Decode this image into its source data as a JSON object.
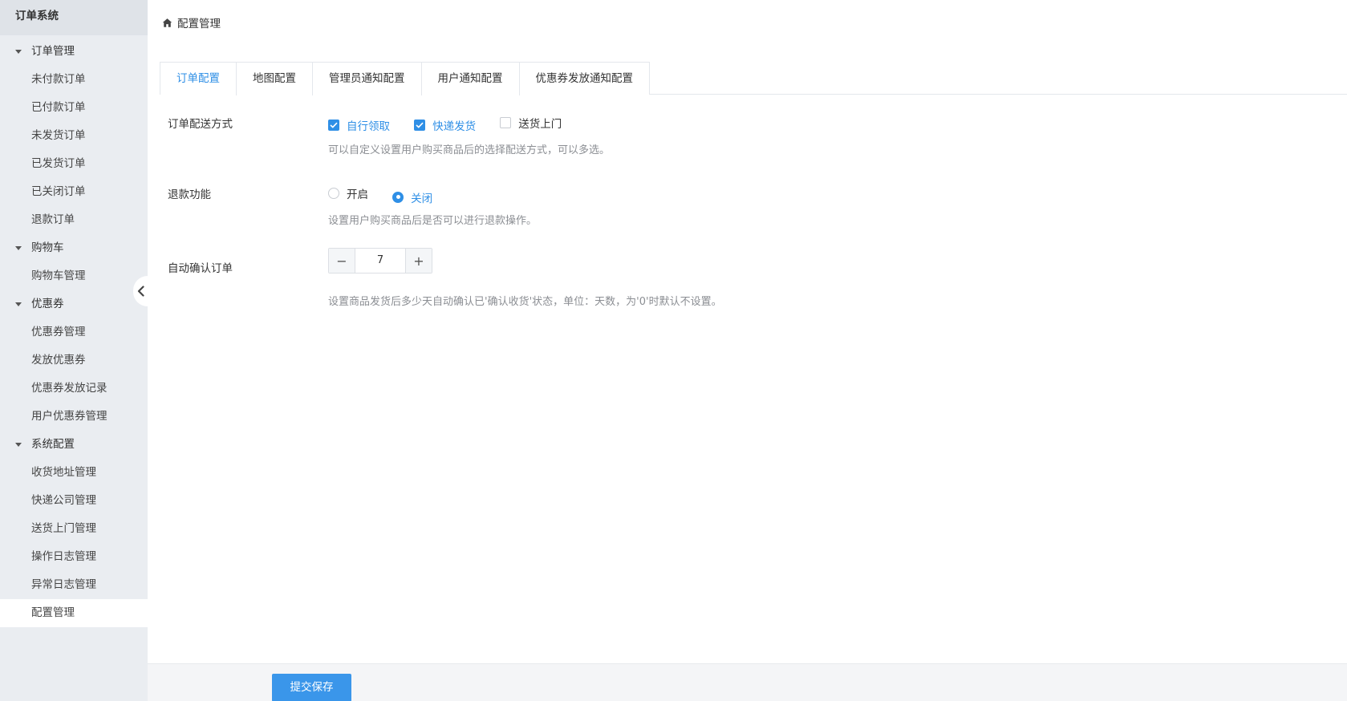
{
  "sidebar": {
    "title": "订单系统",
    "groups": [
      {
        "label": "订单管理",
        "items": [
          "未付款订单",
          "已付款订单",
          "未发货订单",
          "已发货订单",
          "已关闭订单",
          "退款订单"
        ]
      },
      {
        "label": "购物车",
        "items": [
          "购物车管理"
        ]
      },
      {
        "label": "优惠券",
        "items": [
          "优惠券管理",
          "发放优惠券",
          "优惠券发放记录",
          "用户优惠券管理"
        ]
      },
      {
        "label": "系统配置",
        "items": [
          "收货地址管理",
          "快递公司管理",
          "送货上门管理",
          "操作日志管理",
          "异常日志管理",
          "配置管理"
        ]
      }
    ],
    "active_item": "配置管理"
  },
  "breadcrumb": {
    "icon": "home-icon",
    "label": "配置管理"
  },
  "tabs": [
    {
      "label": "订单配置",
      "active": true
    },
    {
      "label": "地图配置",
      "active": false
    },
    {
      "label": "管理员通知配置",
      "active": false
    },
    {
      "label": "用户通知配置",
      "active": false
    },
    {
      "label": "优惠券发放通知配置",
      "active": false
    }
  ],
  "form": {
    "delivery": {
      "label": "订单配送方式",
      "options": [
        {
          "label": "自行领取",
          "checked": true
        },
        {
          "label": "快递发货",
          "checked": true
        },
        {
          "label": "送货上门",
          "checked": false
        }
      ],
      "hint": "可以自定义设置用户购买商品后的选择配送方式，可以多选。"
    },
    "refund": {
      "label": "退款功能",
      "options": [
        {
          "label": "开启",
          "checked": false
        },
        {
          "label": "关闭",
          "checked": true
        }
      ],
      "hint": "设置用户购买商品后是否可以进行退款操作。"
    },
    "auto_confirm": {
      "label": "自动确认订单",
      "value": "7",
      "minus": "−",
      "plus": "+",
      "hint": "设置商品发货后多少天自动确认已'确认收货'状态，单位：天数，为'0'时默认不设置。"
    }
  },
  "footer": {
    "submit_label": "提交保存"
  },
  "colors": {
    "accent": "#2f8fe6",
    "sidebar_bg": "#eaedf1",
    "button": "#3a96ea"
  }
}
